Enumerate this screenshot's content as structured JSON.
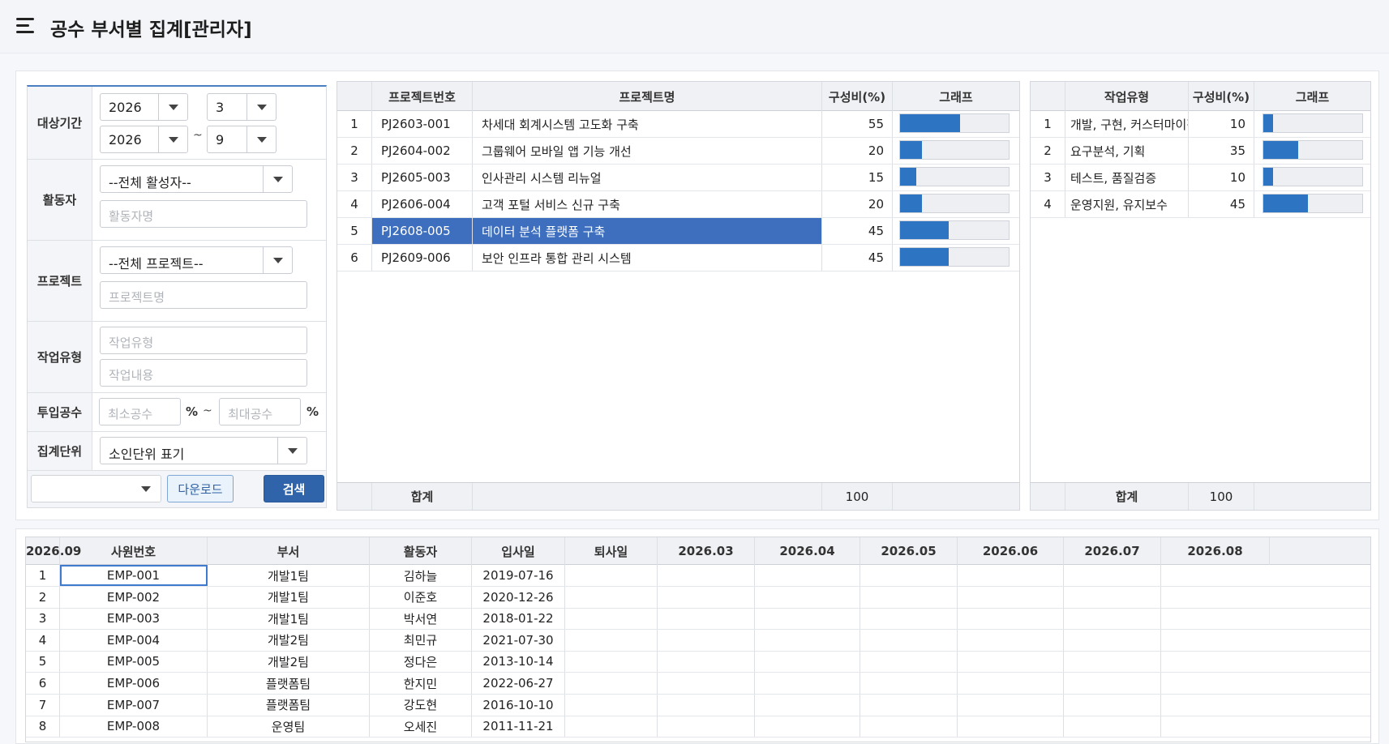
{
  "header": {
    "title": "공수 부서별 집계[관리자]"
  },
  "filter": {
    "period_label": "대상기간",
    "start_year": "2026",
    "start_month": "3",
    "end_year": "2026",
    "end_month": "9",
    "tilde": "~",
    "worker_label": "활동자",
    "worker_select": "--전체 활성자--",
    "worker_placeholder": "활동자명",
    "project_label": "프로젝트",
    "project_select": "--전체 프로젝트--",
    "project_placeholder": "프로젝트명",
    "worktype_label": "작업유형",
    "worktype_placeholder": "작업유형",
    "workcontent_placeholder": "작업내용",
    "effort_label": "투입공수",
    "min_placeholder": "최소공수",
    "max_placeholder": "최대공수",
    "percent": "%",
    "unit_label": "집계단위",
    "unit_select": "소인단위 표기",
    "download_label": "다운로드",
    "search_label": "검색"
  },
  "project_grid": {
    "headers": [
      "프로젝트번호",
      "프로젝트명",
      "구성비(%)",
      "그래프"
    ],
    "rows": [
      {
        "no": "1",
        "code": "PJ2603-001",
        "name": "차세대 회계시스템 고도화 구축",
        "ratio": "55",
        "bar": 0.55
      },
      {
        "no": "2",
        "code": "PJ2604-002",
        "name": "그룹웨어 모바일 앱 기능 개선",
        "ratio": "20",
        "bar": 0.2
      },
      {
        "no": "3",
        "code": "PJ2605-003",
        "name": "인사관리 시스템 리뉴얼",
        "ratio": "15",
        "bar": 0.15
      },
      {
        "no": "4",
        "code": "PJ2606-004",
        "name": "고객 포털 서비스 신규 구축",
        "ratio": "20",
        "bar": 0.2
      },
      {
        "no": "5",
        "code": "PJ2608-005",
        "name": "데이터 분석 플랫폼 구축",
        "ratio": "45",
        "bar": 0.45
      },
      {
        "no": "6",
        "code": "PJ2609-006",
        "name": "보안 인프라 통합 관리 시스템",
        "ratio": "45",
        "bar": 0.45
      }
    ],
    "footer_label": "합계",
    "footer_total": "100"
  },
  "worktype_grid": {
    "headers": [
      "작업유형",
      "구성비(%)",
      "그래프"
    ],
    "rows": [
      {
        "no": "1",
        "type": "개발, 구현, 커스터마이징",
        "ratio": "10",
        "bar": 0.1
      },
      {
        "no": "2",
        "type": "요구분석, 기획",
        "ratio": "35",
        "bar": 0.35
      },
      {
        "no": "3",
        "type": "테스트, 품질검증",
        "ratio": "10",
        "bar": 0.1
      },
      {
        "no": "4",
        "type": "운영지원, 유지보수",
        "ratio": "45",
        "bar": 0.45
      }
    ],
    "footer_label": "합계",
    "footer_total": "100"
  },
  "employee_grid": {
    "headers": [
      "사원번호",
      "부서",
      "활동자",
      "입사일",
      "퇴사일",
      "2026.03",
      "2026.04",
      "2026.05",
      "2026.06",
      "2026.07",
      "2026.08",
      "2026.09"
    ],
    "rows": [
      {
        "no": "1",
        "emp": "EMP-001",
        "dept": "개발1팀",
        "name": "김하늘",
        "join": "2019-07-16"
      },
      {
        "no": "2",
        "emp": "EMP-002",
        "dept": "개발1팀",
        "name": "이준호",
        "join": "2020-12-26"
      },
      {
        "no": "3",
        "emp": "EMP-003",
        "dept": "개발1팀",
        "name": "박서연",
        "join": "2018-01-22"
      },
      {
        "no": "4",
        "emp": "EMP-004",
        "dept": "개발2팀",
        "name": "최민규",
        "join": "2021-07-30"
      },
      {
        "no": "5",
        "emp": "EMP-005",
        "dept": "개발2팀",
        "name": "정다은",
        "join": "2013-10-14"
      },
      {
        "no": "6",
        "emp": "EMP-006",
        "dept": "플랫폼팀",
        "name": "한지민",
        "join": "2022-06-27"
      },
      {
        "no": "7",
        "emp": "EMP-007",
        "dept": "플랫폼팀",
        "name": "강도현",
        "join": "2016-10-10"
      },
      {
        "no": "8",
        "emp": "EMP-008",
        "dept": "운영팀",
        "name": "오세진",
        "join": "2011-11-21"
      }
    ]
  },
  "colors": {
    "accent": "#2f64aa",
    "selected_row": "#3d6fbe",
    "bar": "#2d75c2"
  }
}
